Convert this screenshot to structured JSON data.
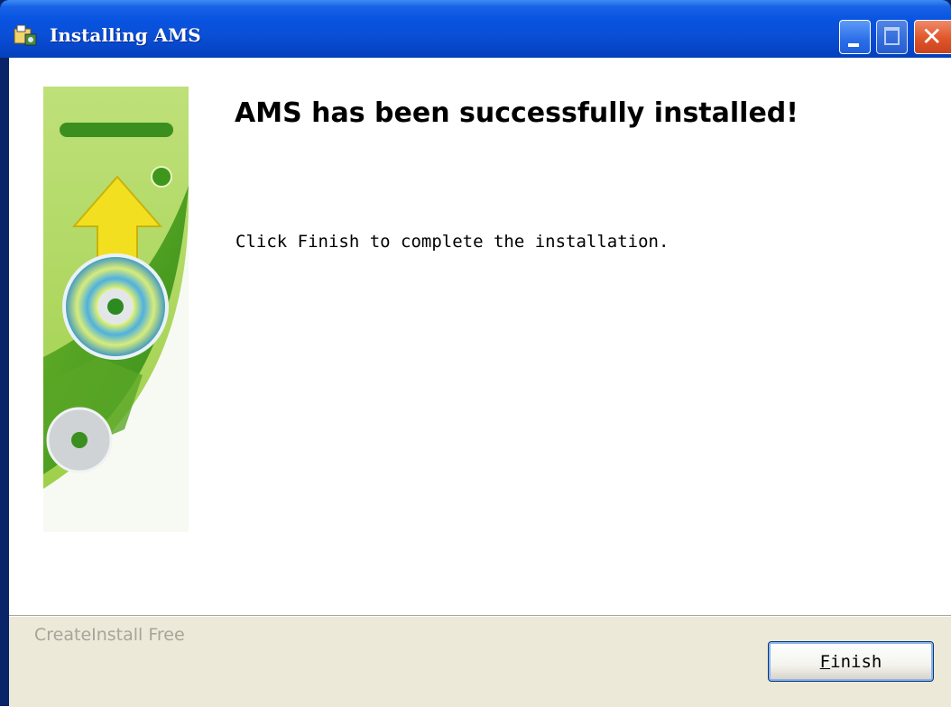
{
  "window": {
    "title": "Installing AMS"
  },
  "content": {
    "heading": "AMS has been successfully installed!",
    "message": "Click Finish to complete the installation."
  },
  "footer": {
    "brand": "CreateInstall Free",
    "finish_mnemonic": "F",
    "finish_rest": "inish"
  },
  "colors": {
    "titlebar": "#0a4fd6",
    "footer_bg": "#ece9d8",
    "close_button": "#e0552a",
    "brand_text": "#a7a499"
  },
  "icons": [
    "installer-icon",
    "minimize-icon",
    "maximize-icon",
    "close-icon",
    "cd-install-graphic"
  ]
}
